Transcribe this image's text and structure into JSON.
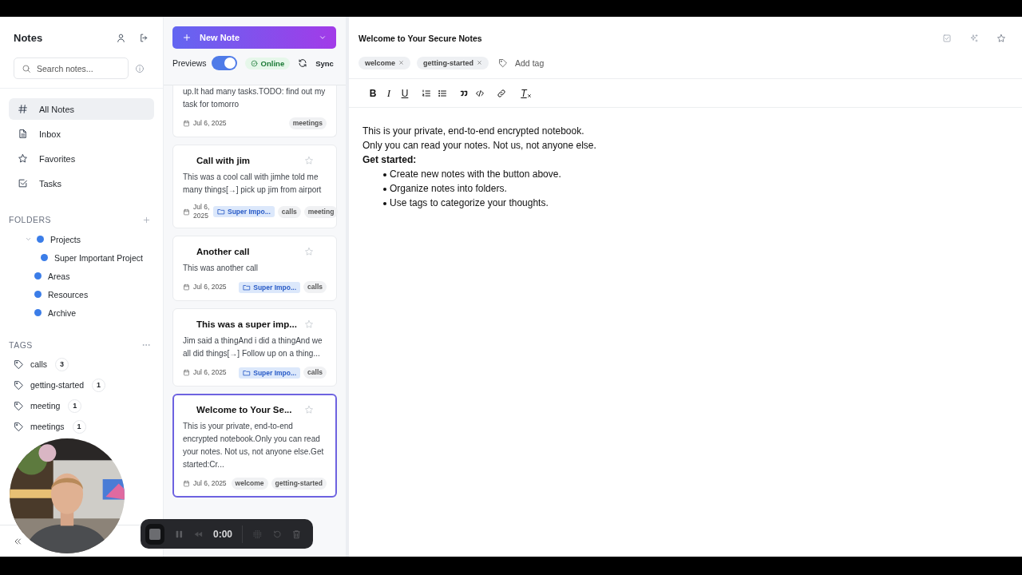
{
  "sidebar": {
    "title": "Notes",
    "search": {
      "placeholder": "Search notes..."
    },
    "nav": [
      {
        "kind": "all",
        "label": "All Notes",
        "selected": true
      },
      {
        "kind": "inbox",
        "label": "Inbox",
        "selected": false
      },
      {
        "kind": "favorites",
        "label": "Favorites",
        "selected": false
      },
      {
        "kind": "tasks",
        "label": "Tasks",
        "selected": false
      }
    ],
    "folders": {
      "heading": "FOLDERS",
      "items": [
        {
          "name": "Projects",
          "expanded": true,
          "children": [
            {
              "name": "Super Important Project"
            }
          ]
        },
        {
          "name": "Areas"
        },
        {
          "name": "Resources"
        },
        {
          "name": "Archive"
        }
      ]
    },
    "tags": {
      "heading": "TAGS",
      "items": [
        {
          "name": "calls",
          "count": "3"
        },
        {
          "name": "getting-started",
          "count": "1"
        },
        {
          "name": "meeting",
          "count": "1"
        },
        {
          "name": "meetings",
          "count": "1"
        }
      ]
    }
  },
  "note_list": {
    "new_button": "New Note",
    "previews": {
      "label": "Previews",
      "on": true
    },
    "status": "Online",
    "sync": "Sync",
    "notes": [
      {
        "kind": "partial",
        "preview": "up.It had many tasks.TODO: find out my task for tomorro",
        "date": "Jul 6, 2025",
        "tags": [
          "meetings"
        ],
        "selected": false
      },
      {
        "kind": "full",
        "title": "Call with jim",
        "preview": "This was a cool call with jimhe told me many things[→] pick up jim from airport",
        "date": "Jul 6, 2025",
        "folder": "Super Impo...",
        "tags": [
          "calls",
          "meeting"
        ],
        "selected": false
      },
      {
        "kind": "full",
        "title": "Another call",
        "preview": "This was another call",
        "date": "Jul 6, 2025",
        "folder": "Super Impo...",
        "tags": [
          "calls"
        ],
        "selected": false
      },
      {
        "kind": "full",
        "title": "This was a super imp...",
        "preview": "Jim said a thingAnd i did a thingAnd we all did things[→] Follow up on a thing...",
        "date": "Jul 6, 2025",
        "folder": "Super Impo...",
        "tags": [
          "calls"
        ],
        "selected": false
      },
      {
        "kind": "full",
        "title": "Welcome to Your Se...",
        "preview": "This is your private, end-to-end encrypted notebook.Only you can read your notes. Not us, not anyone else.Get started:Cr...",
        "date": "Jul 6, 2025",
        "tags": [
          "welcome",
          "getting-started"
        ],
        "selected": true
      }
    ]
  },
  "editor": {
    "title": "Welcome to Your Secure Notes",
    "tags": [
      "welcome",
      "getting-started"
    ],
    "add_tag": "Add tag",
    "toolbar": [
      {
        "kind": "bold",
        "label": "B"
      },
      {
        "kind": "italic",
        "label": "I"
      },
      {
        "kind": "underline",
        "label": "U"
      },
      {
        "kind": "ordered-list"
      },
      {
        "kind": "bullet-list"
      },
      {
        "kind": "quote"
      },
      {
        "kind": "code"
      },
      {
        "kind": "link"
      },
      {
        "kind": "clear",
        "label": "T"
      }
    ],
    "content": [
      {
        "kind": "paragraph",
        "text": "This is your private, end-to-end encrypted notebook."
      },
      {
        "kind": "paragraph",
        "text": "Only you can read your notes. Not us, not anyone else."
      },
      {
        "kind": "heading",
        "text": "Get started:"
      },
      {
        "kind": "bullet",
        "text": "Create new notes with the button above."
      },
      {
        "kind": "bullet",
        "text": "Organize notes into folders."
      },
      {
        "kind": "bullet",
        "text": "Use tags to categorize your thoughts."
      }
    ]
  },
  "recorder": {
    "time": "0:00"
  }
}
